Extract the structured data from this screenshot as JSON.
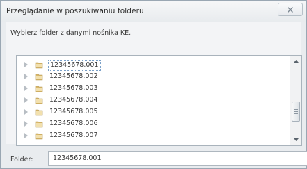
{
  "window": {
    "title": "Przeglądanie w poszukiwaniu folderu",
    "close_label": "X"
  },
  "dialog": {
    "prompt": "Wybierz folder z danymi nośnika KE."
  },
  "tree": {
    "items": [
      {
        "label": "12345678.001",
        "selected": true
      },
      {
        "label": "12345678.002"
      },
      {
        "label": "12345678.003"
      },
      {
        "label": "12345678.004"
      },
      {
        "label": "12345678.005"
      },
      {
        "label": "12345678.006"
      },
      {
        "label": "12345678.007"
      }
    ],
    "item_icon": "folder-icon",
    "expander_icon": "expand-arrow-icon"
  },
  "folder_field": {
    "label": "Folder:",
    "value": "12345678.001"
  },
  "colors": {
    "folder": "#d8b76a",
    "selection_outline": "#7aa0c8"
  }
}
